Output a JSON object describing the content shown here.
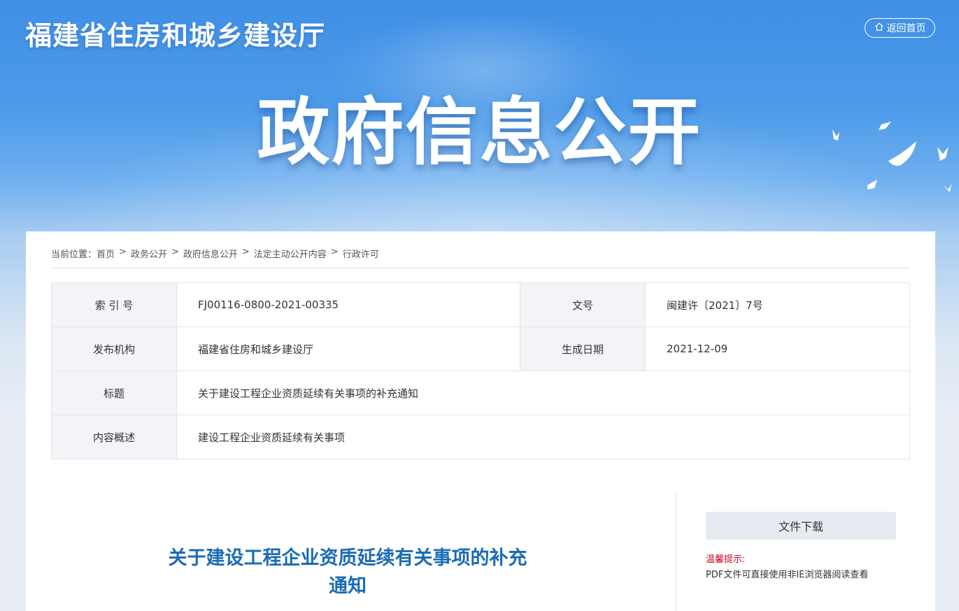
{
  "header": {
    "site_title": "福建省住房和城乡建设厅",
    "back_home_label": "返回首页",
    "hero_title": "政府信息公开"
  },
  "breadcrumb": {
    "prefix": "当前位置：",
    "items": [
      "首页",
      "政务公开",
      "政府信息公开",
      "法定主动公开内容",
      "行政许可"
    ],
    "separator": ">"
  },
  "meta": {
    "index_label": "索 引 号",
    "index_value": "FJ00116-0800-2021-00335",
    "doc_no_label": "文号",
    "doc_no_value": "闽建许〔2021〕7号",
    "issuer_label": "发布机构",
    "issuer_value": "福建省住房和城乡建设厅",
    "date_label": "生成日期",
    "date_value": "2021-12-09",
    "title_label": "标题",
    "title_value": "关于建设工程企业资质延续有关事项的补充通知",
    "summary_label": "内容概述",
    "summary_value": "建设工程企业资质延续有关事项"
  },
  "document": {
    "title_line1": "关于建设工程企业资质延续有关事项的补充",
    "title_line2": "通知"
  },
  "side": {
    "download_label": "文件下载",
    "tip_label": "温馨提示:",
    "tip_text": "PDF文件可直接使用非IE浏览器阅读查看"
  },
  "colors": {
    "banner_blue": "#3f8fe6",
    "doc_title": "#1a6bb5",
    "tip_red": "#d0021b"
  }
}
